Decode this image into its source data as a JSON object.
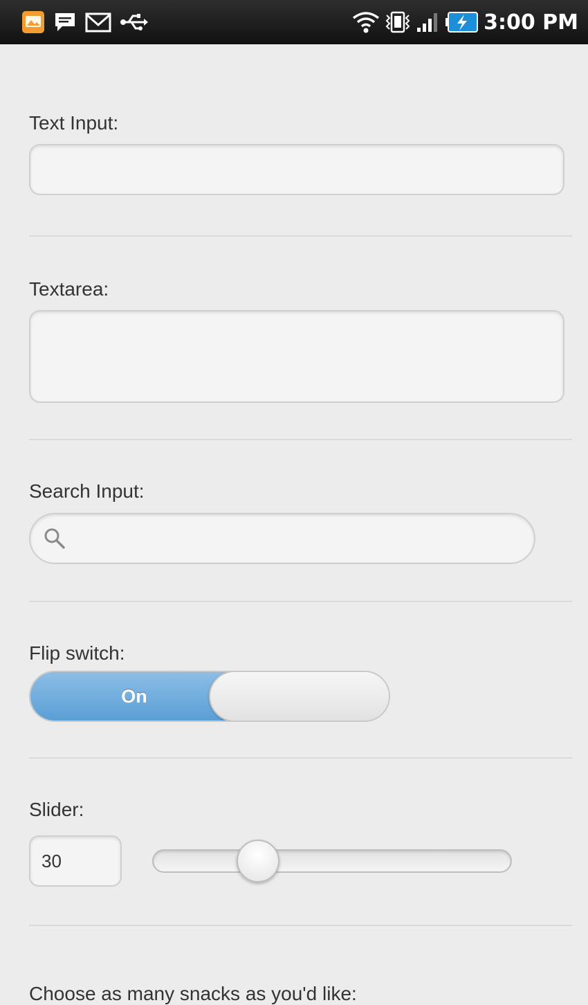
{
  "status_bar": {
    "time": "3:00 PM",
    "left_icons": [
      "app-notification-icon",
      "chat-icon",
      "gmail-icon",
      "usb-icon"
    ],
    "right_icons": [
      "wifi-icon",
      "vibrate-icon",
      "signal-icon",
      "battery-charging-icon"
    ],
    "colors": {
      "background": "#1a1a1a",
      "battery_accent": "#1c8fd8",
      "app_icon": "#f39c32"
    }
  },
  "form": {
    "text_input": {
      "label": "Text Input:",
      "value": ""
    },
    "textarea": {
      "label": "Textarea:",
      "value": ""
    },
    "search_input": {
      "label": "Search Input:",
      "value": ""
    },
    "flip_switch": {
      "label": "Flip switch:",
      "on_label": "On",
      "state": "on"
    },
    "slider": {
      "label": "Slider:",
      "value": "30",
      "min": 0,
      "max": 100,
      "fraction": 0.3
    },
    "snacks": {
      "label": "Choose as many snacks as you'd like:"
    },
    "colors": {
      "page_background": "#ececec",
      "accent": "#5b9fd6"
    }
  }
}
